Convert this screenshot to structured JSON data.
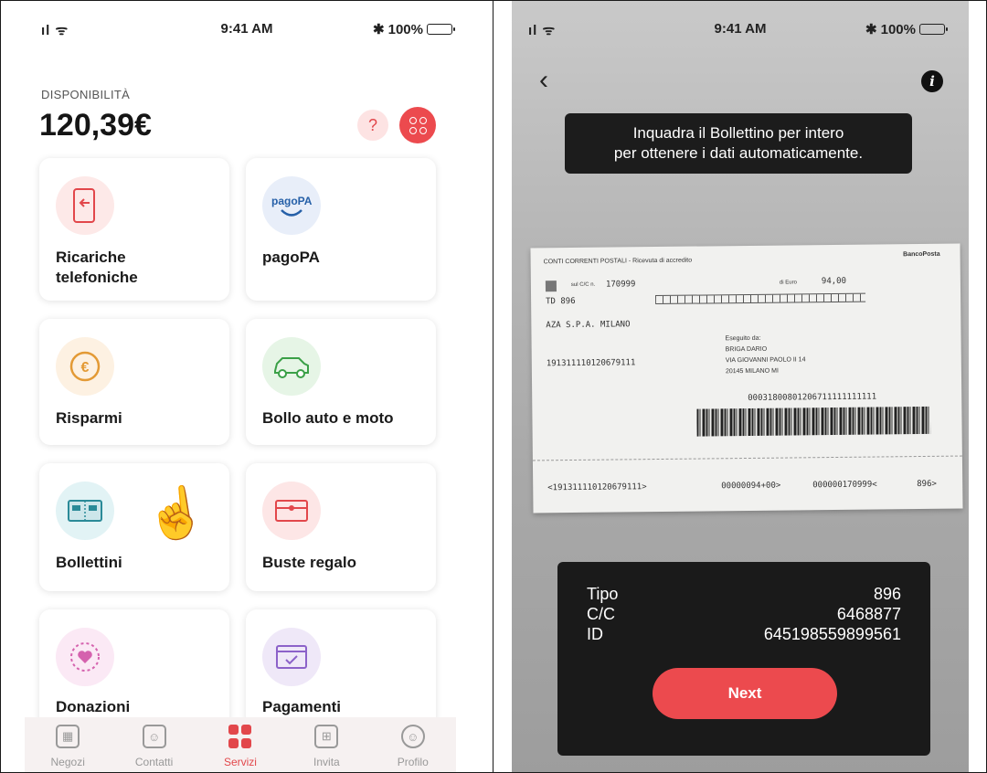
{
  "left": {
    "status": {
      "time": "9:41 AM",
      "signal": "ıl ᯤ",
      "battery": "100%"
    },
    "header": {
      "label": "DISPONIBILITÀ",
      "balance": "120,39€",
      "help": "?"
    },
    "cards": [
      {
        "label_l1": "Ricariche",
        "label_l2": "telefoniche",
        "icon": "phone-recharge-icon"
      },
      {
        "label_l1": "pagoPA",
        "label_l2": "",
        "icon": "pagopa-logo-icon",
        "logo_text": "pagoPA"
      },
      {
        "label_l1": "Risparmi",
        "label_l2": "",
        "icon": "euro-coin-icon",
        "glyph": "€"
      },
      {
        "label_l1": "Bollo auto e moto",
        "label_l2": "",
        "icon": "car-icon"
      },
      {
        "label_l1": "Bollettini",
        "label_l2": "",
        "icon": "bill-slip-icon"
      },
      {
        "label_l1": "Buste regalo",
        "label_l2": "",
        "icon": "gift-envelope-icon"
      },
      {
        "label_l1": "Donazioni",
        "label_l2": "",
        "icon": "heart-donation-icon"
      },
      {
        "label_l1": "Pagamenti",
        "label_l2": "",
        "icon": "payment-card-icon"
      }
    ],
    "tabs": [
      {
        "label": "Negozi",
        "icon": "shop-icon"
      },
      {
        "label": "Contatti",
        "icon": "contacts-icon"
      },
      {
        "label": "Servizi",
        "icon": "services-icon",
        "active": true
      },
      {
        "label": "Invita",
        "icon": "gift-icon"
      },
      {
        "label": "Profilo",
        "icon": "profile-icon"
      }
    ]
  },
  "right": {
    "status": {
      "time": "9:41 AM",
      "signal": "ıl ᯤ",
      "battery": "100%"
    },
    "instruction": {
      "line1": "Inquadra il Bollettino per intero",
      "line2": "per ottenere i dati automaticamente."
    },
    "slip": {
      "header": "CONTI CORRENTI POSTALI - Ricevuta di accredito",
      "brand": "BancoPosta",
      "account_label": "sul C/C n.",
      "account": "170999",
      "amount_label": "di Euro",
      "amount": "94,00",
      "td": "TD  896",
      "payee": "AZA S.P.A. MILANO",
      "code": "191311110120679111",
      "payer_label": "Eseguito da:",
      "payer_name": "BRIGA DARIO",
      "payer_addr": "VIA GIOVANNI PAOLO II 14",
      "payer_city": "20145 MILANO MI",
      "long_code": "00031800801206711111111111",
      "ocr_1": "<191311110120679111>",
      "ocr_2": "00000094+00>",
      "ocr_3": "000000170999<",
      "ocr_4": "896>"
    },
    "result": {
      "rows": [
        {
          "label": "Tipo",
          "value": "896"
        },
        {
          "label": "C/C",
          "value": "6468877"
        },
        {
          "label": "ID",
          "value": "645198559899561"
        }
      ],
      "button": "Next"
    }
  },
  "colors": {
    "accent": "#ec4a4e",
    "tab_inactive": "#999999",
    "overlay": "#1a1a1a"
  }
}
